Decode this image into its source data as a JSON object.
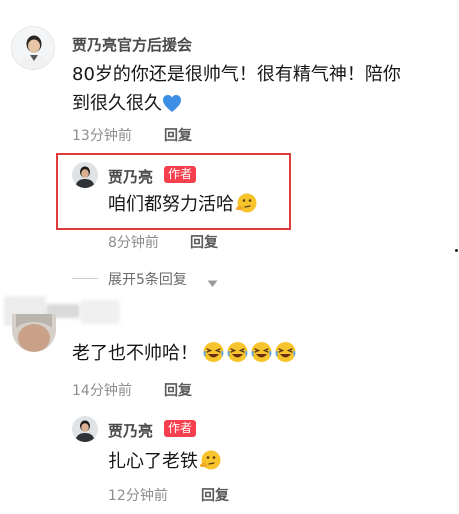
{
  "comment1": {
    "username": "贾乃亮官方后援会",
    "text_line1": "80岁的你还是很帅气！很有精气神！陪你",
    "text_line2": "到很久很久",
    "heart_emoji_name": "blue-heart-icon",
    "time": "13分钟前",
    "reply_label": "回复"
  },
  "reply1": {
    "username": "贾乃亮",
    "author_tag": "作者",
    "text": "咱们都努力活哈",
    "emoji_name": "thinking-face-icon",
    "time": "8分钟前",
    "reply_label": "回复"
  },
  "expand": {
    "label": "展开5条回复"
  },
  "comment2": {
    "text": "老了也不帅哈！",
    "emoji_name": "rolling-laughing-face-icon",
    "emoji_count": 4,
    "time": "14分钟前",
    "reply_label": "回复"
  },
  "reply2": {
    "username": "贾乃亮",
    "author_tag": "作者",
    "text": "扎心了老铁",
    "emoji_name": "thinking-face-icon",
    "time": "12分钟前",
    "reply_label": "回复"
  },
  "colors": {
    "author_tag_bg": "#f53f4e",
    "highlight_border": "#e03b3b",
    "heart": "#3d8fe6",
    "emoji_yellow": "#f8c42c"
  }
}
